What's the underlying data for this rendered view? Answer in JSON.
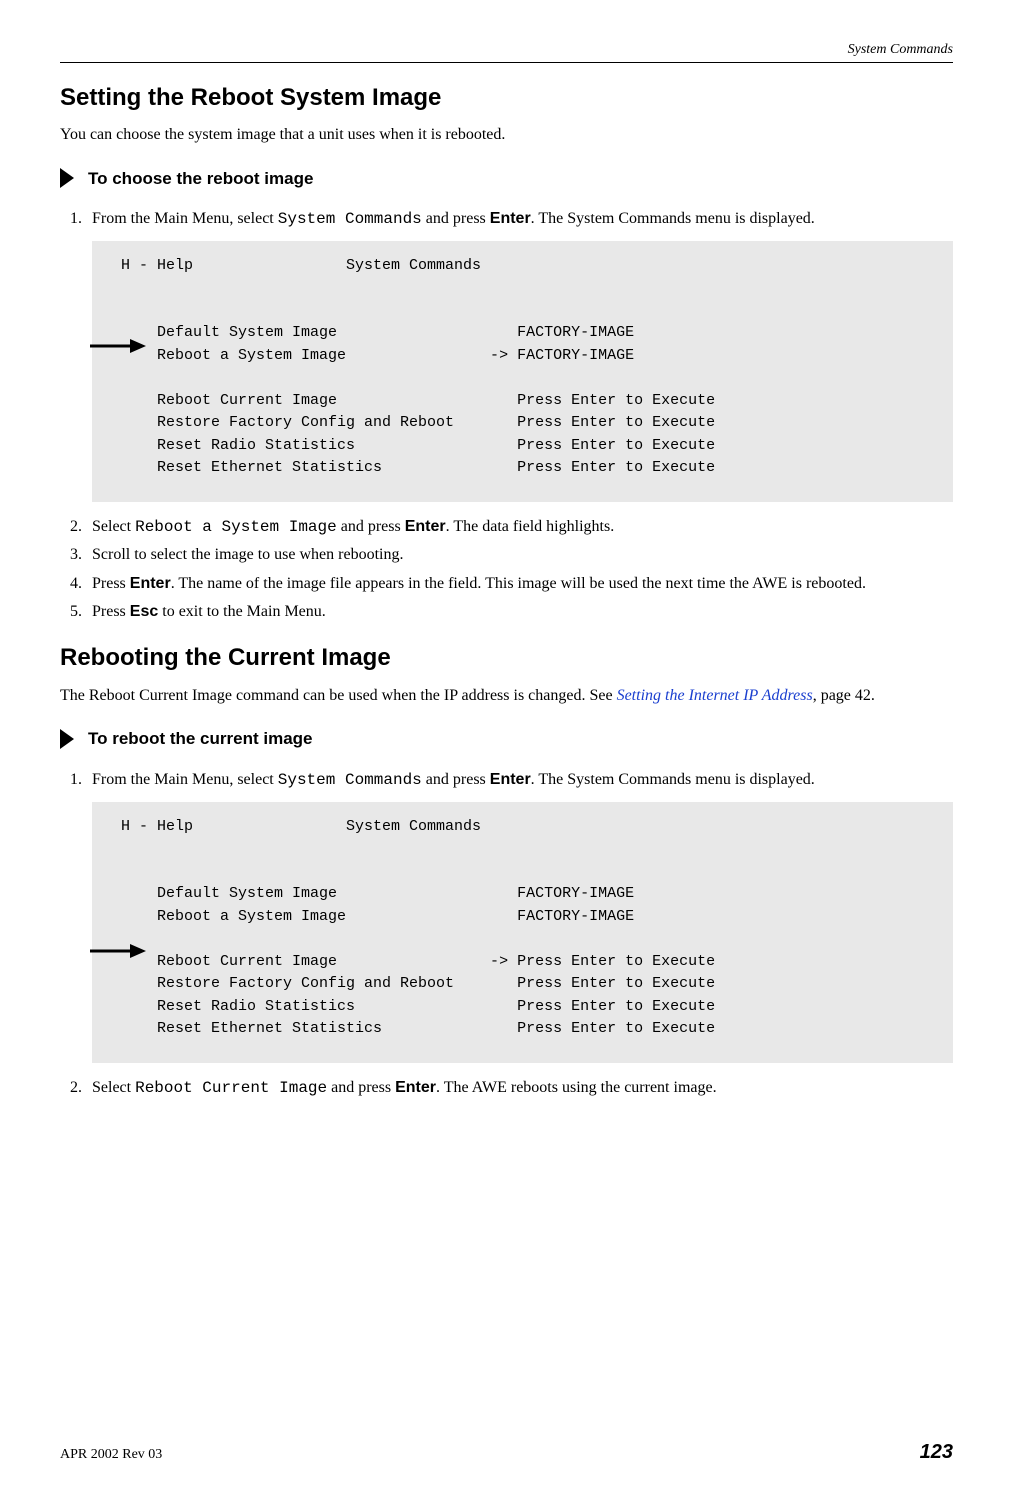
{
  "header": {
    "section": "System Commands"
  },
  "section1": {
    "title": "Setting the Reboot System Image",
    "intro": "You can choose the system image that a unit uses when it is rebooted.",
    "procedure_heading": "To choose the reboot image",
    "steps": {
      "s1a": "From the Main Menu, select ",
      "s1_code": "System Commands",
      "s1b": " and press ",
      "s1_bold": "Enter",
      "s1c": ". The System Commands menu is displayed.",
      "code": " H - Help                 System Commands\n\n\n     Default System Image                    FACTORY-IMAGE\n     Reboot a System Image                -> FACTORY-IMAGE\n\n     Reboot Current Image                    Press Enter to Execute\n     Restore Factory Config and Reboot       Press Enter to Execute\n     Reset Radio Statistics                  Press Enter to Execute\n     Reset Ethernet Statistics               Press Enter to Execute\n",
      "s2a": "Select ",
      "s2_code": "Reboot a System Image",
      "s2b": " and press ",
      "s2_bold": "Enter",
      "s2c": ". The data field highlights.",
      "s3": "Scroll to select the image to use when rebooting.",
      "s4a": "Press ",
      "s4_bold": "Enter",
      "s4b": ". The name of the image file appears in the field. This image will be used the next time the AWE is rebooted.",
      "s5a": "Press ",
      "s5_bold": "Esc",
      "s5b": " to exit to the Main Menu."
    }
  },
  "section2": {
    "title": "Rebooting the Current Image",
    "intro_a": "The Reboot Current Image command can be used when the IP address is changed. See ",
    "intro_link": "Setting the Internet IP Address",
    "intro_b": ", page 42.",
    "procedure_heading": "To reboot the current image",
    "steps": {
      "s1a": "From the Main Menu, select ",
      "s1_code": "System Commands",
      "s1b": " and press ",
      "s1_bold": "Enter",
      "s1c": ". The System Commands menu is displayed.",
      "code": " H - Help                 System Commands\n\n\n     Default System Image                    FACTORY-IMAGE\n     Reboot a System Image                   FACTORY-IMAGE\n\n     Reboot Current Image                 -> Press Enter to Execute\n     Restore Factory Config and Reboot       Press Enter to Execute\n     Reset Radio Statistics                  Press Enter to Execute\n     Reset Ethernet Statistics               Press Enter to Execute\n",
      "s2a": "Select ",
      "s2_code": "Reboot Current Image",
      "s2b": " and press ",
      "s2_bold": "Enter",
      "s2c": ". The AWE reboots using the current image."
    }
  },
  "footer": {
    "rev": "APR 2002 Rev 03",
    "page": "123"
  }
}
